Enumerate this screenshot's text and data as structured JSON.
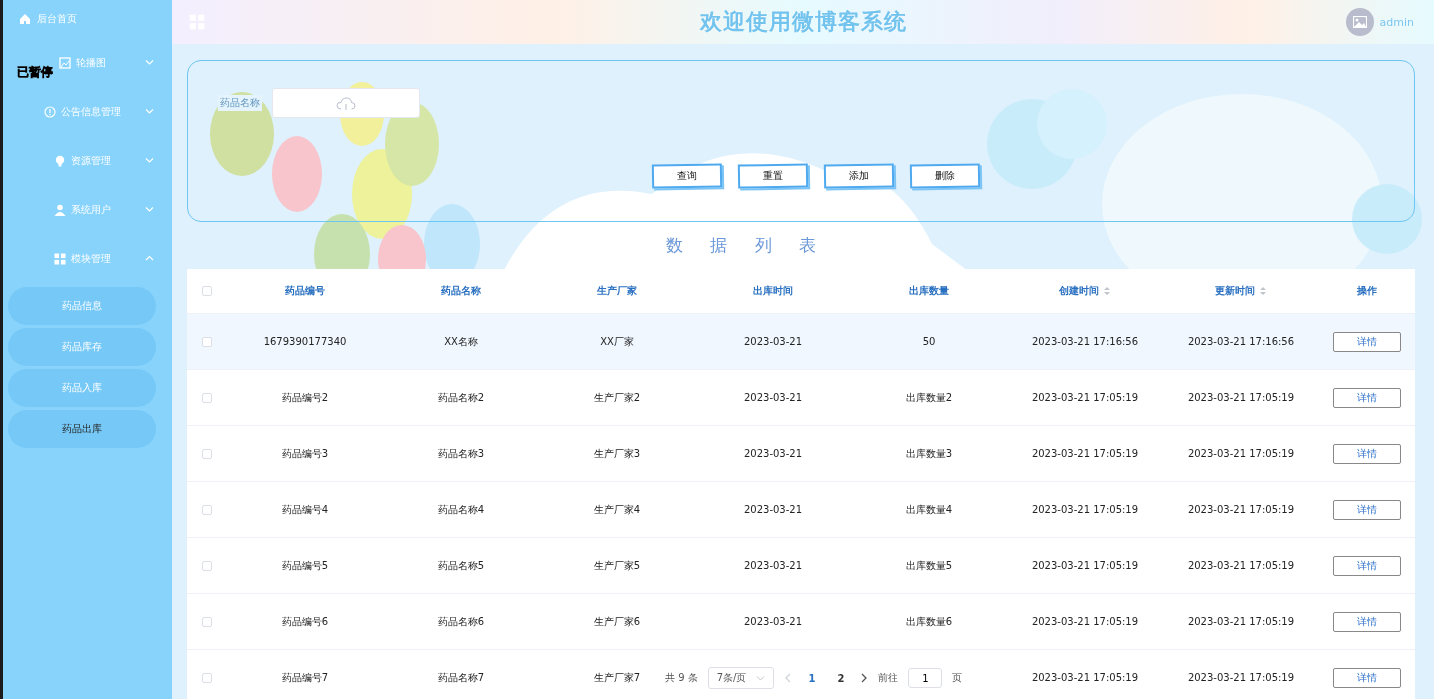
{
  "header": {
    "title": "欢迎使用微博客系统",
    "user_name": "admin"
  },
  "sidebar": {
    "home": "后台首页",
    "menus": [
      {
        "label": "轮播图",
        "expanded": false
      },
      {
        "label": "公告信息管理",
        "expanded": false
      },
      {
        "label": "资源管理",
        "expanded": false
      },
      {
        "label": "系统用户",
        "expanded": false
      },
      {
        "label": "模块管理",
        "expanded": true,
        "children": [
          {
            "label": "药品信息",
            "selected": false
          },
          {
            "label": "药品库存",
            "selected": false
          },
          {
            "label": "药品入库",
            "selected": false
          },
          {
            "label": "药品出库",
            "selected": true
          }
        ]
      }
    ]
  },
  "overlay_label": "已暂停",
  "search": {
    "label": "药品名称",
    "buttons": [
      "查询",
      "重置",
      "添加",
      "删除"
    ]
  },
  "table": {
    "title": "数据列表",
    "header_checked": false,
    "columns": [
      {
        "label": "药品编号",
        "sortable": false
      },
      {
        "label": "药品名称",
        "sortable": false
      },
      {
        "label": "生产厂家",
        "sortable": false
      },
      {
        "label": "出库时间",
        "sortable": false
      },
      {
        "label": "出库数量",
        "sortable": false
      },
      {
        "label": "创建时间",
        "sortable": true
      },
      {
        "label": "更新时间",
        "sortable": true
      },
      {
        "label": "操作",
        "sortable": false
      }
    ],
    "rows": [
      {
        "checked": false,
        "hovered": true,
        "cells": [
          "1679390177340",
          "XX名称",
          "XX厂家",
          "2023-03-21",
          "50",
          "2023-03-21 17:16:56",
          "2023-03-21 17:16:56"
        ],
        "action": "详情"
      },
      {
        "checked": false,
        "hovered": false,
        "cells": [
          "药品编号2",
          "药品名称2",
          "生产厂家2",
          "2023-03-21",
          "出库数量2",
          "2023-03-21 17:05:19",
          "2023-03-21 17:05:19"
        ],
        "action": "详情"
      },
      {
        "checked": false,
        "hovered": false,
        "cells": [
          "药品编号3",
          "药品名称3",
          "生产厂家3",
          "2023-03-21",
          "出库数量3",
          "2023-03-21 17:05:19",
          "2023-03-21 17:05:19"
        ],
        "action": "详情"
      },
      {
        "checked": false,
        "hovered": false,
        "cells": [
          "药品编号4",
          "药品名称4",
          "生产厂家4",
          "2023-03-21",
          "出库数量4",
          "2023-03-21 17:05:19",
          "2023-03-21 17:05:19"
        ],
        "action": "详情"
      },
      {
        "checked": false,
        "hovered": false,
        "cells": [
          "药品编号5",
          "药品名称5",
          "生产厂家5",
          "2023-03-21",
          "出库数量5",
          "2023-03-21 17:05:19",
          "2023-03-21 17:05:19"
        ],
        "action": "详情"
      },
      {
        "checked": false,
        "hovered": false,
        "cells": [
          "药品编号6",
          "药品名称6",
          "生产厂家6",
          "2023-03-21",
          "出库数量6",
          "2023-03-21 17:05:19",
          "2023-03-21 17:05:19"
        ],
        "action": "详情"
      },
      {
        "checked": false,
        "hovered": false,
        "cells": [
          "药品编号7",
          "药品名称7",
          "生产厂家7",
          null,
          null,
          "2023-03-21 17:05:19",
          "2023-03-21 17:05:19"
        ],
        "action": "详情"
      }
    ]
  },
  "pagination": {
    "total": "共 9 条",
    "page_size": "7条/页",
    "pages": [
      {
        "label": "1",
        "selected": true
      },
      {
        "label": "2",
        "selected": false
      }
    ],
    "goto_label": "前往",
    "goto_value": "1",
    "goto_suffix": "页"
  }
}
